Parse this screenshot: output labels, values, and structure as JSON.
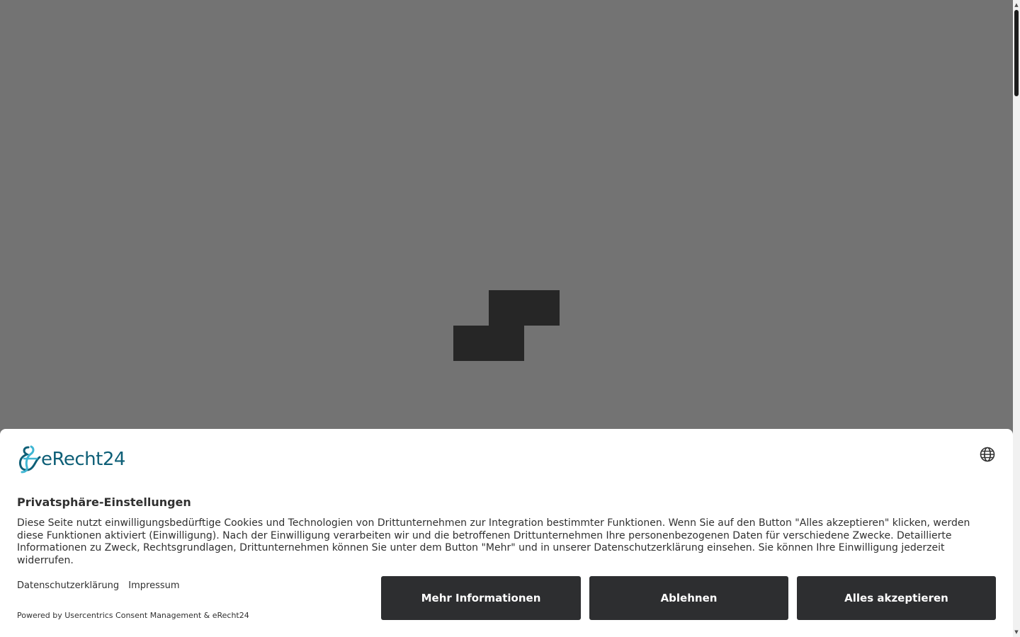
{
  "banner": {
    "logo_text": "eRecht24",
    "title": "Privatsphäre-Einstellungen",
    "message": "Diese Seite nutzt einwilligungsbedürftige Cookies und Technologien von Drittunternehmen zur Integration bestimmter Funktionen. Wenn Sie auf den Button \"Alles akzeptieren\" klicken, werden diese Funktionen aktiviert (Einwilligung). Nach der Einwilligung verarbeiten wir und die betroffenen Drittunternehmen Ihre personenbezogenen Daten für verschiedene Zwecke. Detaillierte Informationen zu Zweck, Rechtsgrundlagen, Drittunternehmen können Sie unter dem Button \"Mehr\" und in unserer Datenschutzerklärung einsehen. Sie können Ihre Einwilligung jederzeit widerrufen.",
    "links": {
      "privacy_policy": "Datenschutzerklärung",
      "imprint": "Impressum"
    },
    "powered_by": "Powered by Usercentrics Consent Management & eRecht24",
    "buttons": {
      "more_info": "Mehr Informationen",
      "deny": "Ablehnen",
      "accept_all": "Alles akzeptieren"
    }
  },
  "icons": {
    "language": "globe-icon",
    "logo": "erecht24-logo-icon"
  },
  "colors": {
    "overlay": "#737373",
    "loader": "#262626",
    "button_bg": "#2d2e30",
    "logo_primary": "#0e5f77",
    "logo_accent": "#3fb6d3"
  }
}
